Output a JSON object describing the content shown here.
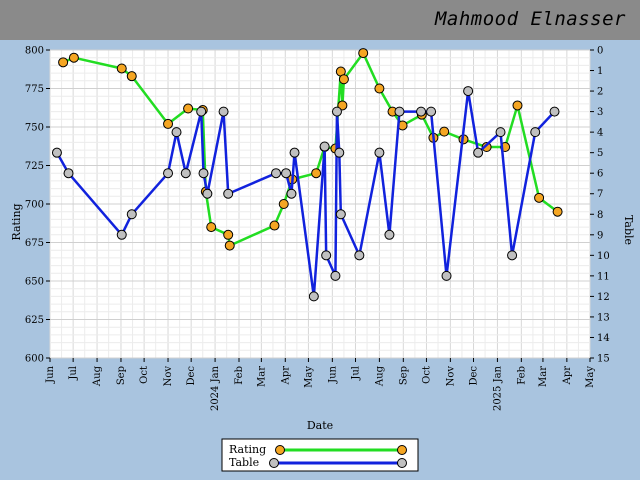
{
  "header": {
    "title": "Mahmood Elnasser"
  },
  "chart_data": {
    "type": "line",
    "title": "Mahmood Elnasser",
    "xlabel": "Date",
    "ylabel": "Rating",
    "y2label": "Table",
    "xlim": [
      "2023-06-01",
      "2025-05-01"
    ],
    "ylim": [
      600,
      800
    ],
    "y2lim": [
      15,
      0
    ],
    "y2_inverted": true,
    "grid": true,
    "legend_position": "bottom",
    "x_ticks": [
      "Jun",
      "Jul",
      "Aug",
      "Sep",
      "Oct",
      "Nov",
      "Dec",
      "2024 Jan",
      "Feb",
      "Mar",
      "Apr",
      "May",
      "Jun",
      "Jul",
      "Aug",
      "Sep",
      "Oct",
      "Nov",
      "Dec",
      "2025 Jan",
      "Feb",
      "Mar",
      "Apr",
      "May"
    ],
    "y_ticks": [
      "600",
      "625",
      "650",
      "675",
      "700",
      "725",
      "750",
      "775",
      "800"
    ],
    "y2_ticks": [
      "0",
      "1",
      "2",
      "3",
      "4",
      "5",
      "6",
      "7",
      "8",
      "9",
      "10",
      "11",
      "12",
      "13",
      "14",
      "15"
    ],
    "series": [
      {
        "name": "Rating",
        "axis": "left",
        "color": "#22dd22",
        "marker_color": "#f5a623",
        "points": [
          [
            "2023-06-18",
            792
          ],
          [
            "2023-07-02",
            795
          ],
          [
            "2023-09-02",
            788
          ],
          [
            "2023-09-15",
            783
          ],
          [
            "2023-11-01",
            752
          ],
          [
            "2023-11-27",
            762
          ],
          [
            "2023-12-16",
            761
          ],
          [
            "2023-12-20",
            708
          ],
          [
            "2023-12-27",
            685
          ],
          [
            "2024-01-18",
            680
          ],
          [
            "2024-01-20",
            673
          ],
          [
            "2024-03-18",
            686
          ],
          [
            "2024-03-30",
            700
          ],
          [
            "2024-04-10",
            716
          ],
          [
            "2024-05-11",
            720
          ],
          [
            "2024-05-22",
            737
          ],
          [
            "2024-06-05",
            736
          ],
          [
            "2024-06-12",
            786
          ],
          [
            "2024-06-14",
            764
          ],
          [
            "2024-06-16",
            781
          ],
          [
            "2024-07-11",
            798
          ],
          [
            "2024-08-01",
            775
          ],
          [
            "2024-08-18",
            760
          ],
          [
            "2024-08-31",
            751
          ],
          [
            "2024-09-25",
            758
          ],
          [
            "2024-10-10",
            743
          ],
          [
            "2024-10-24",
            747
          ],
          [
            "2024-11-18",
            742
          ],
          [
            "2024-12-18",
            737
          ],
          [
            "2025-01-11",
            737
          ],
          [
            "2025-01-27",
            764
          ],
          [
            "2025-02-24",
            704
          ],
          [
            "2025-03-20",
            695
          ]
        ]
      },
      {
        "name": "Table",
        "axis": "right",
        "color": "#1122dd",
        "marker_color": "#c0c0c0",
        "points": [
          [
            "2023-06-10",
            5
          ],
          [
            "2023-06-25",
            6
          ],
          [
            "2023-09-02",
            9
          ],
          [
            "2023-09-15",
            8
          ],
          [
            "2023-11-01",
            6
          ],
          [
            "2023-11-12",
            4
          ],
          [
            "2023-11-24",
            6
          ],
          [
            "2023-12-14",
            3
          ],
          [
            "2023-12-17",
            6
          ],
          [
            "2023-12-22",
            7
          ],
          [
            "2024-01-12",
            3
          ],
          [
            "2024-01-18",
            7
          ],
          [
            "2024-03-20",
            6
          ],
          [
            "2024-04-02",
            6
          ],
          [
            "2024-04-09",
            7
          ],
          [
            "2024-04-13",
            5
          ],
          [
            "2024-05-08",
            12
          ],
          [
            "2024-05-22",
            4.7
          ],
          [
            "2024-05-24",
            10
          ],
          [
            "2024-06-05",
            11
          ],
          [
            "2024-06-07",
            3
          ],
          [
            "2024-06-10",
            5
          ],
          [
            "2024-06-12",
            8
          ],
          [
            "2024-07-06",
            10
          ],
          [
            "2024-08-01",
            5
          ],
          [
            "2024-08-14",
            9
          ],
          [
            "2024-08-27",
            3
          ],
          [
            "2024-09-24",
            3
          ],
          [
            "2024-10-07",
            3
          ],
          [
            "2024-10-27",
            11
          ],
          [
            "2024-11-24",
            2
          ],
          [
            "2024-12-07",
            5
          ],
          [
            "2025-01-05",
            4
          ],
          [
            "2025-01-20",
            10
          ],
          [
            "2025-02-19",
            4
          ],
          [
            "2025-03-16",
            3
          ]
        ]
      }
    ]
  }
}
